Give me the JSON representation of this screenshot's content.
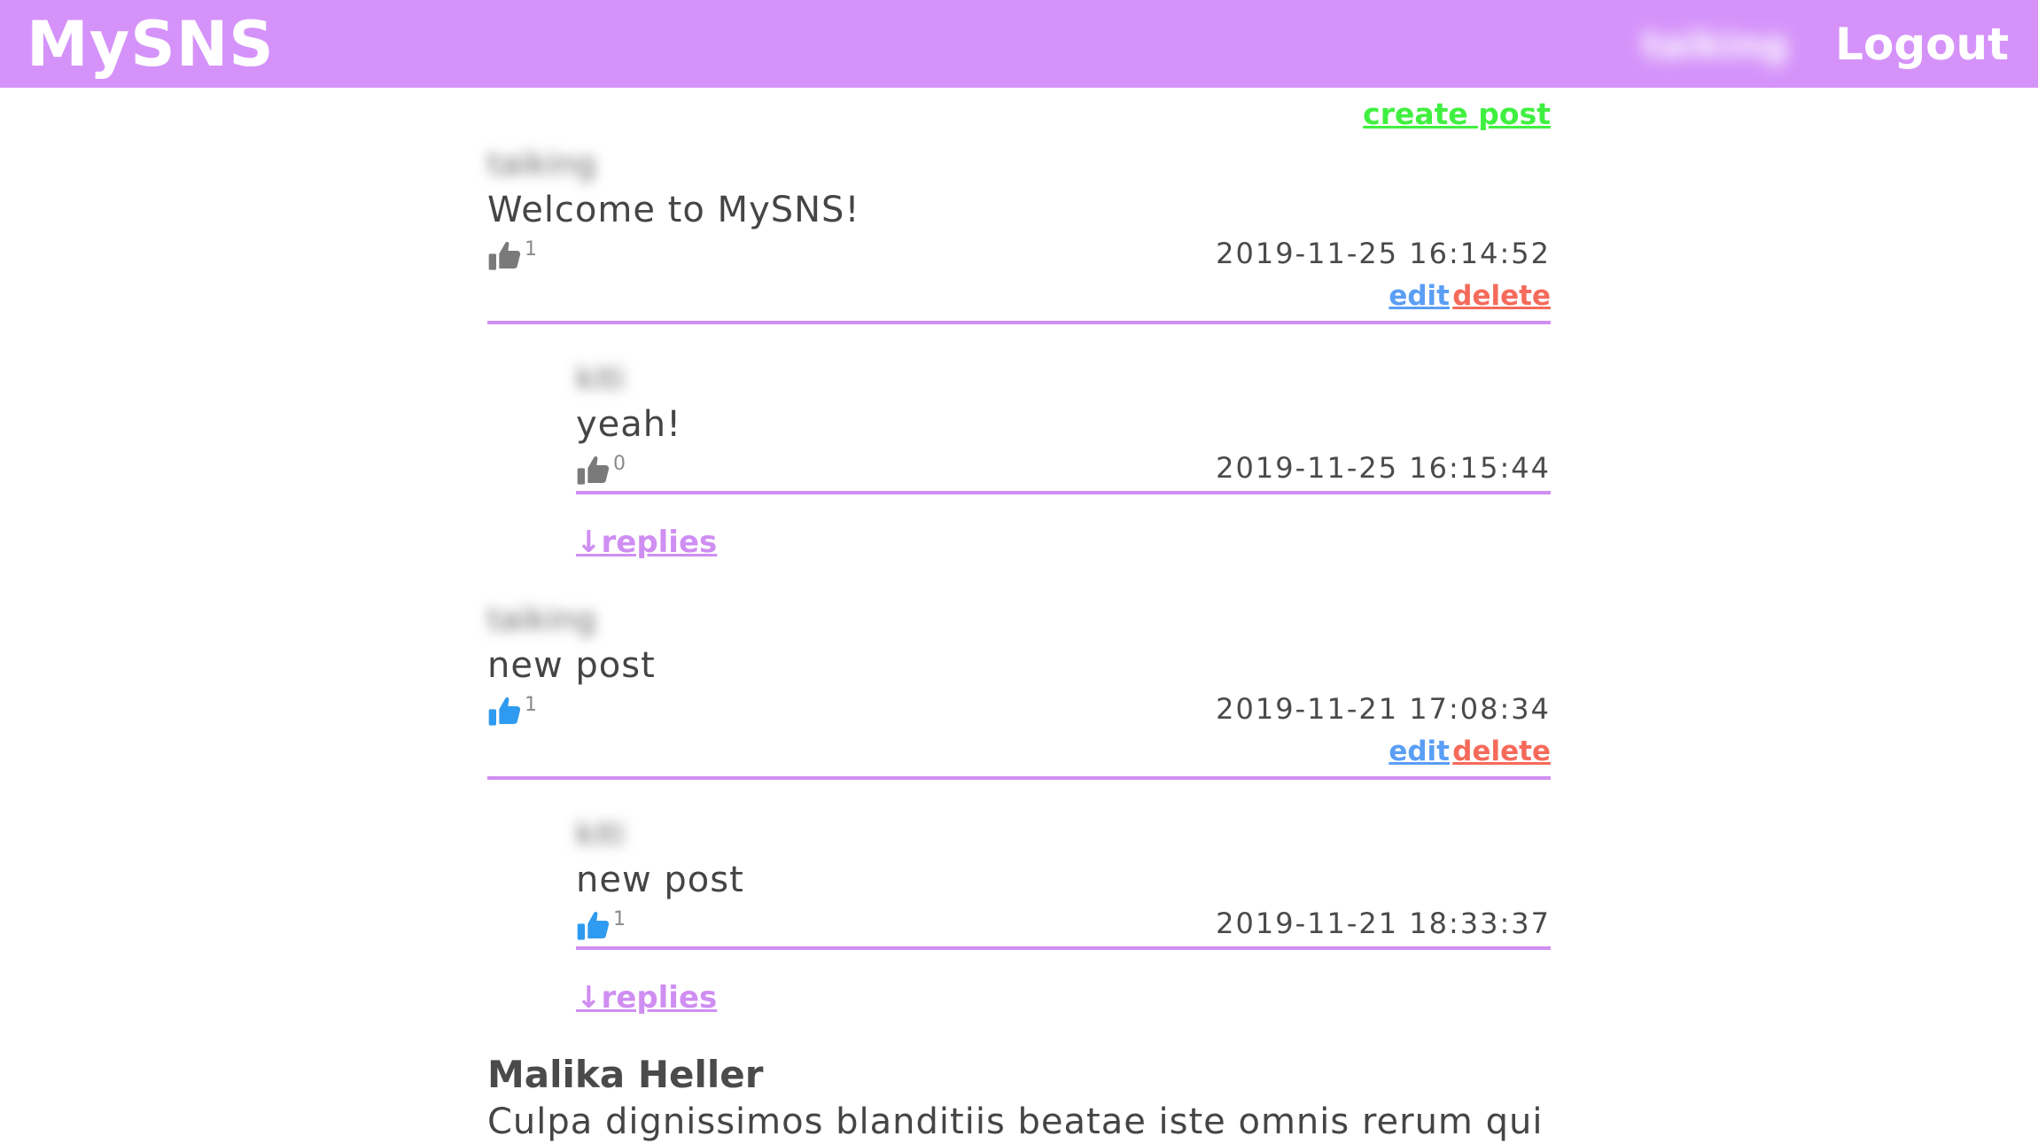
{
  "header": {
    "brand": "MySNS",
    "username": "taiking",
    "logout_label": "Logout",
    "bg_color": "#d593fa"
  },
  "create_post_label": "create post",
  "posts": [
    {
      "author": "taiking",
      "content": "Welcome to MySNS!",
      "likes": "1",
      "liked": false,
      "date": "2019-11-25 16:14:52",
      "edit_label": "edit",
      "delete_label": "delete",
      "reply": {
        "author": "kiti",
        "content": "yeah!",
        "likes": "0",
        "liked": false,
        "date": "2019-11-25 16:15:44"
      },
      "replies_label": "↓replies"
    },
    {
      "author": "taiking",
      "content": "new post",
      "likes": "1",
      "liked": true,
      "date": "2019-11-21 17:08:34",
      "edit_label": "edit",
      "delete_label": "delete",
      "reply": {
        "author": "kiti",
        "content": "new post",
        "likes": "1",
        "liked": true,
        "date": "2019-11-21 18:33:37"
      },
      "replies_label": "↓replies"
    },
    {
      "author": "Malika Heller",
      "content": "Culpa dignissimos blanditiis beatae iste omnis rerum qui"
    }
  ],
  "colors": {
    "accent": "#cf8ef2",
    "create": "#40f040",
    "edit": "#5a9ef5",
    "delete": "#f56a5a",
    "like_active": "#2f9bf0",
    "like_inactive": "#7a7a7a"
  }
}
